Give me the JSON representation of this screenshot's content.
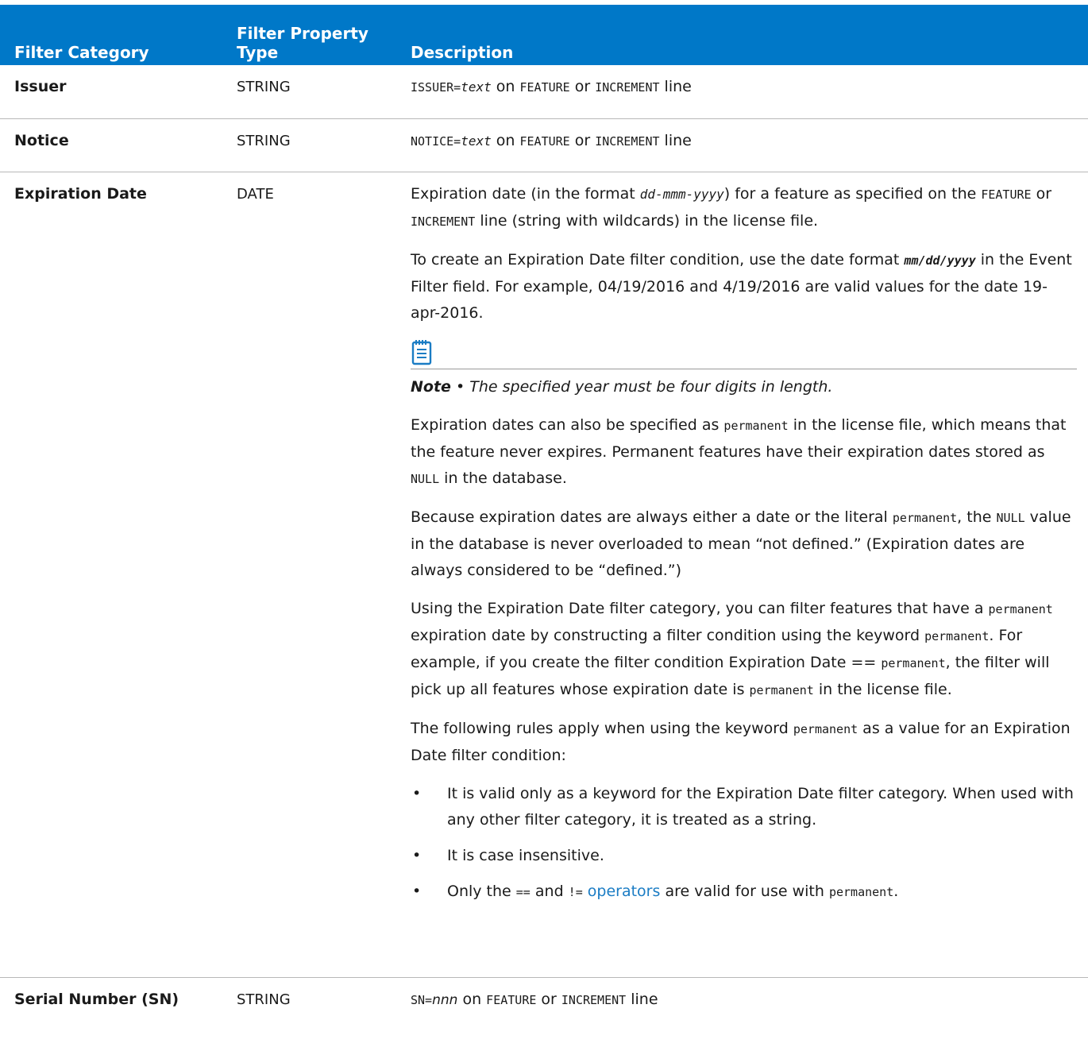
{
  "table": {
    "headers": [
      "Filter Category",
      "Filter Property Type",
      "Description"
    ],
    "header_type_line1": "Filter Property",
    "header_type_line2": "Type",
    "accent_color": "#0078c8",
    "link_color": "#1a7cc4",
    "rows": {
      "issuer": {
        "category": "Issuer",
        "type": "STRING",
        "desc": {
          "code1": "ISSUER=",
          "code1_it": "text",
          "t1": " on ",
          "code2": "FEATURE",
          "t2": " or ",
          "code3": "INCREMENT",
          "t3": " line"
        }
      },
      "notice": {
        "category": "Notice",
        "type": "STRING",
        "desc": {
          "code1": "NOTICE=",
          "code1_it": "text",
          "t1": " on ",
          "code2": "FEATURE",
          "t2": " or ",
          "code3": "INCREMENT",
          "t3": " line"
        }
      },
      "expiration": {
        "category": "Expiration Date",
        "type": "DATE",
        "p1": {
          "a": "Expiration date (in the format ",
          "fmt": "dd-mmm-yyyy",
          "b": ") for a feature as specified on the ",
          "code1": "FEATURE",
          "c": " or ",
          "code2": "INCREMENT",
          "d": " line (string with wildcards) in the license file."
        },
        "p2": {
          "a": "To create an Expiration Date filter condition, use the date format ",
          "fmt": "mm/dd/yyyy",
          "b": "  in the Event Filter field",
          "c": ". For example, 04/19/2016 and 4/19/2016 are valid values for the date 19-apr-2016."
        },
        "note_icon": "notepad-icon",
        "note": {
          "label": "Note",
          "sep": " • ",
          "text": "The specified year must be four digits in length."
        },
        "p3": {
          "a": "Expiration dates can also be specified as ",
          "code1": "permanent",
          "b": " in the license file, which means that the feature never expires. Permanent features have their expiration dates stored as ",
          "code2": "NULL",
          "c": " in the database."
        },
        "p4": {
          "a": "Because expiration dates are always either a date or the literal ",
          "code1": "permanent",
          "b": ", the ",
          "code2": "NULL",
          "c": " value in the database is never overloaded to mean “not defined.” (Expiration dates are always considered to be “defined.”)"
        },
        "p5": {
          "a": "Using the Expiration Date filter category, you can filter features that have a ",
          "code1": "permanent",
          "b": " expiration date by constructing a filter condition using the keyword ",
          "code2": "permanent",
          "c": ". For example, if you create the filter condition Expiration Date == ",
          "code3": "permanent",
          "d": ", the filter will pick up all features whose expiration date is ",
          "code4": "permanent",
          "e": " in the license file."
        },
        "p6": {
          "a": "The following rules apply when using the keyword ",
          "code1": "permanent",
          "b": " as a value for an Expiration Date filter condition:"
        },
        "bullet_char": "•",
        "bullets": {
          "b1": "It is valid only as a keyword for the Expiration Date filter category. When used with any other filter category, it is treated as a string.",
          "b2": "It is case insensitive.",
          "b3": {
            "a": "Only the ",
            "code1": "==",
            "b": " and ",
            "code2": "!=",
            "link": "operators",
            "c": " are valid for use with ",
            "code3": "permanent",
            "d": "."
          }
        }
      },
      "serial": {
        "category": "Serial Number (SN)",
        "type": "STRING",
        "desc": {
          "code1": "SN=",
          "code1_it": "nnn",
          "t1": " on ",
          "code2": "FEATURE",
          "t2": " or ",
          "code3": "INCREMENT",
          "t3": " line"
        }
      }
    }
  }
}
